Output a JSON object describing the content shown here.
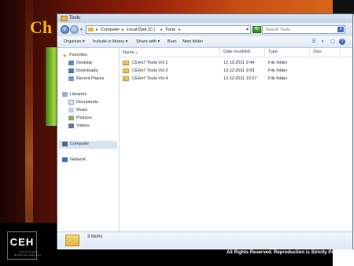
{
  "slide": {
    "title": "Ch",
    "logo_text": "CEH",
    "logo_subtext": "Certified Ethical Hacker",
    "copyright": "All Rights Reserved. Reproduction is Strictly Prohibited."
  },
  "window": {
    "title": "Tools",
    "address": {
      "crumbs": [
        "Computer",
        "Local Disk (C:)",
        "Tools"
      ]
    },
    "search": {
      "placeholder": "Search Tools"
    },
    "toolbar": {
      "organize": "Organize ▾",
      "include_in_library": "Include in library ▾",
      "share_with": "Share with ▾",
      "burn": "Burn",
      "new_folder": "New folder"
    },
    "nav": {
      "favorites": "Favorites",
      "desktop": "Desktop",
      "downloads": "Downloads",
      "recent_places": "Recent Places",
      "libraries": "Libraries",
      "documents": "Documents",
      "music": "Music",
      "pictures": "Pictures",
      "videos": "Videos",
      "computer": "Computer",
      "network": "Network"
    },
    "columns": {
      "name": "Name",
      "date_modified": "Date modified",
      "type": "Type",
      "size": "Size"
    },
    "files": [
      {
        "name": "CEHv7 Tools Vol 1",
        "date": "12.12.2011 9:44",
        "type": "File folder",
        "size": ""
      },
      {
        "name": "CEHv7 Tools Vol 2",
        "date": "13.12.2011 9:59",
        "type": "File folder",
        "size": ""
      },
      {
        "name": "CEHv7 Tools Vol 4",
        "date": "12.12.2011 10:27",
        "type": "File folder",
        "size": ""
      }
    ],
    "status": {
      "item_count": "3 items"
    }
  },
  "colors": {
    "accent": "#3f72b8",
    "folder": "#e0b040",
    "slide_title": "#f2b21a"
  }
}
